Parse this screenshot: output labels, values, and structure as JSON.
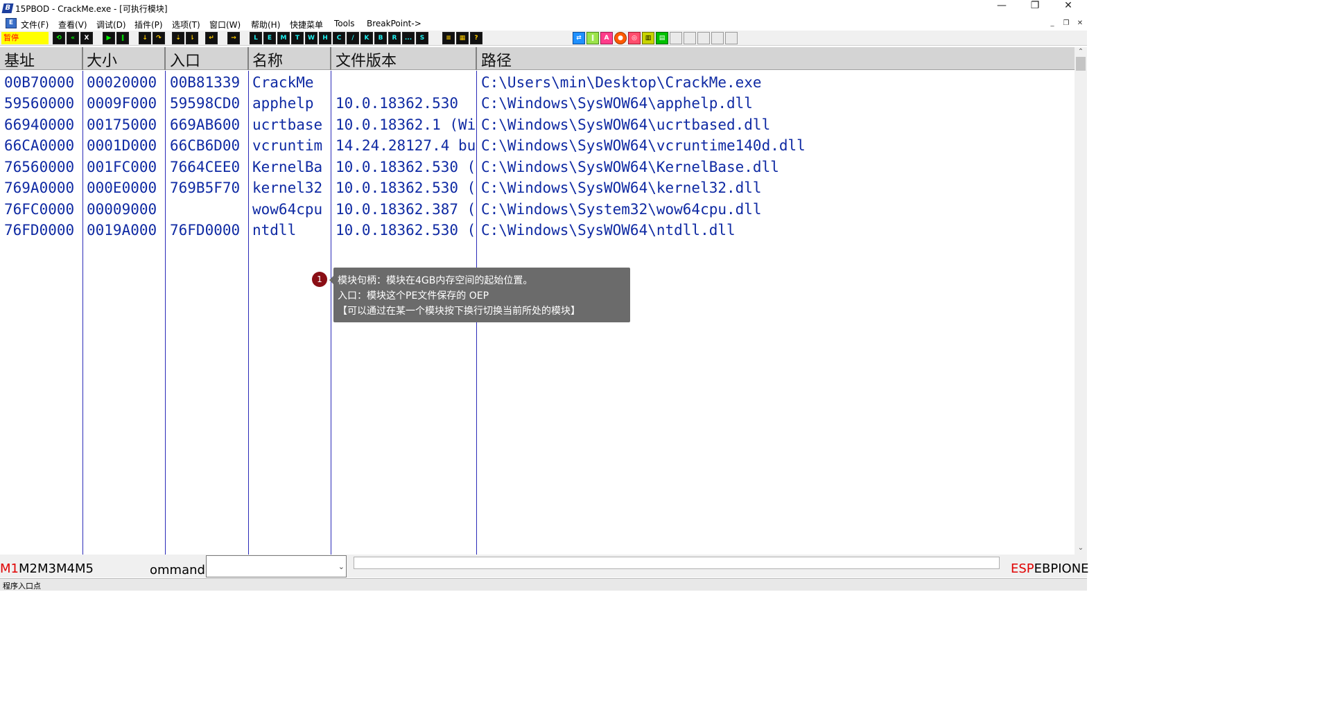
{
  "window": {
    "icon_glyph": "B",
    "title": "15PBOD  - CrackMe.exe - [可执行模块]",
    "minimize": "—",
    "restore": "❐",
    "close": "✕"
  },
  "menu": {
    "icon_glyph": "E",
    "items": [
      "文件(F)",
      "查看(V)",
      "调试(D)",
      "插件(P)",
      "选项(T)",
      "窗口(W)",
      "帮助(H)",
      "快捷菜单",
      "Tools",
      "BreakPoint->"
    ],
    "mdi_minimize": "_",
    "mdi_restore": "❐",
    "mdi_close": "✕"
  },
  "toolbar": {
    "status": "暂停",
    "letters": [
      "L",
      "E",
      "M",
      "T",
      "W",
      "H",
      "C",
      "/",
      "K",
      "B",
      "R",
      "...",
      "S"
    ]
  },
  "columns": [
    "基址",
    "大小",
    "入口",
    "名称",
    "文件版本",
    "路径"
  ],
  "modules": [
    {
      "base": "00B70000",
      "size": "00020000",
      "entry": "00B81339",
      "name": "CrackMe",
      "version": "",
      "path": "C:\\Users\\min\\Desktop\\CrackMe.exe"
    },
    {
      "base": "59560000",
      "size": "0009F000",
      "entry": "59598CD0",
      "name": "apphelp",
      "version": "10.0.18362.530",
      "path": "C:\\Windows\\SysWOW64\\apphelp.dll"
    },
    {
      "base": "66940000",
      "size": "00175000",
      "entry": "669AB600",
      "name": "ucrtbase",
      "version": "10.0.18362.1 (Wi",
      "path": "C:\\Windows\\SysWOW64\\ucrtbased.dll"
    },
    {
      "base": "66CA0000",
      "size": "0001D000",
      "entry": "66CB6D00",
      "name": "vcruntim",
      "version": "14.24.28127.4 bu",
      "path": "C:\\Windows\\SysWOW64\\vcruntime140d.dll"
    },
    {
      "base": "76560000",
      "size": "001FC000",
      "entry": "7664CEE0",
      "name": "KernelBa",
      "version": "10.0.18362.530 (",
      "path": "C:\\Windows\\SysWOW64\\KernelBase.dll"
    },
    {
      "base": "769A0000",
      "size": "000E0000",
      "entry": "769B5F70",
      "name": "kernel32",
      "version": "10.0.18362.530 (",
      "path": "C:\\Windows\\SysWOW64\\kernel32.dll"
    },
    {
      "base": "76FC0000",
      "size": "00009000",
      "entry": "",
      "name": "wow64cpu",
      "version": "10.0.18362.387 (",
      "path": "C:\\Windows\\System32\\wow64cpu.dll"
    },
    {
      "base": "76FD0000",
      "size": "0019A000",
      "entry": "76FD0000",
      "name": "ntdll",
      "version": "10.0.18362.530 (",
      "path": "C:\\Windows\\SysWOW64\\ntdll.dll"
    }
  ],
  "annotation": {
    "number": "1",
    "lines": [
      "模块句柄：模块在4GB内存空间的起始位置。",
      "入口：模块这个PE文件保存的 OEP",
      "【可以通过在某一个模块按下换行切换当前所处的模块】"
    ]
  },
  "commandbar": {
    "tabs": [
      "M1",
      "M2",
      "M3",
      "M4",
      "M5"
    ],
    "label": "ommand",
    "combo_arrow": "⌄",
    "registers": [
      "ESP",
      "EBP",
      "IONE"
    ]
  },
  "statusbar": {
    "text": "程序入口点"
  },
  "colors": {
    "grid_text": "#0f2aa3",
    "grid_lines": "#2a2ab8",
    "header_bg": "#d4d4d4",
    "status_bg": "#ffff00",
    "status_fg": "#ff0000",
    "annotation_badge": "#8a0e15",
    "tooltip_bg": "#6b6b6b"
  }
}
